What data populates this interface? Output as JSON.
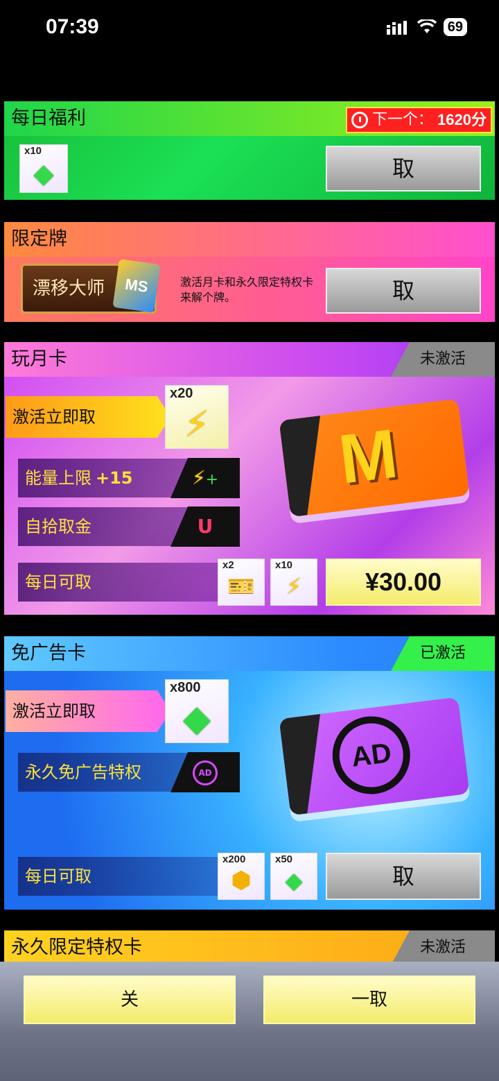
{
  "status_bar": {
    "time": "07:39",
    "battery": "69",
    "signal_icon": "signal-bars-icon",
    "wifi_icon": "wifi-icon"
  },
  "daily": {
    "title": "每日福利",
    "timer_label": "下一个：",
    "timer_value": "1620分",
    "timer_icon": "clock-icon",
    "item": {
      "qty": "x10",
      "icon": "green-gem-icon"
    },
    "claim_label": "取"
  },
  "limited": {
    "title": "限定牌",
    "logo_text": "漂移大师",
    "logo_badge": "MS",
    "description": "激活月卡和永久限定特权卡来解个牌。",
    "claim_label": "取"
  },
  "month_card": {
    "title": "玩月卡",
    "status": "未激活",
    "activate_label": "激活立即取",
    "activate_item": {
      "qty": "x20",
      "icon": "lightning-icon"
    },
    "perks": [
      {
        "label": "能量上限",
        "value": "+15",
        "icon": "energy-plus-icon"
      },
      {
        "label": "自拾取金",
        "value": "",
        "icon": "magnet-icon"
      }
    ],
    "daily_label": "每日可取",
    "daily_items": [
      {
        "qty": "x2",
        "icon": "ticket-icon"
      },
      {
        "qty": "x10",
        "icon": "lightning-icon"
      }
    ],
    "price": "¥30.00",
    "card_letter": "M"
  },
  "noad_card": {
    "title": "免广告卡",
    "status": "已激活",
    "activate_label": "激活立即取",
    "activate_item": {
      "qty": "x800",
      "icon": "green-gem-icon"
    },
    "perk_label": "永久免广告特权",
    "perk_icon": "no-ad-icon",
    "daily_label": "每日可取",
    "daily_items": [
      {
        "qty": "x200",
        "icon": "gold-coin-icon"
      },
      {
        "qty": "x50",
        "icon": "green-gem-icon"
      }
    ],
    "claim_label": "取",
    "card_text": "AD"
  },
  "permanent_card": {
    "title": "永久限定特权卡",
    "status": "未激活"
  },
  "footer": {
    "close_label": "关",
    "claim_all_label": "一取"
  },
  "colors": {
    "daily_green": "#1fd64a",
    "month_purple": "#c447f2",
    "noad_blue": "#2b8bff",
    "perm_yellow": "#ffd21f",
    "active_green": "#33f04a",
    "timer_red": "#ff2020"
  }
}
